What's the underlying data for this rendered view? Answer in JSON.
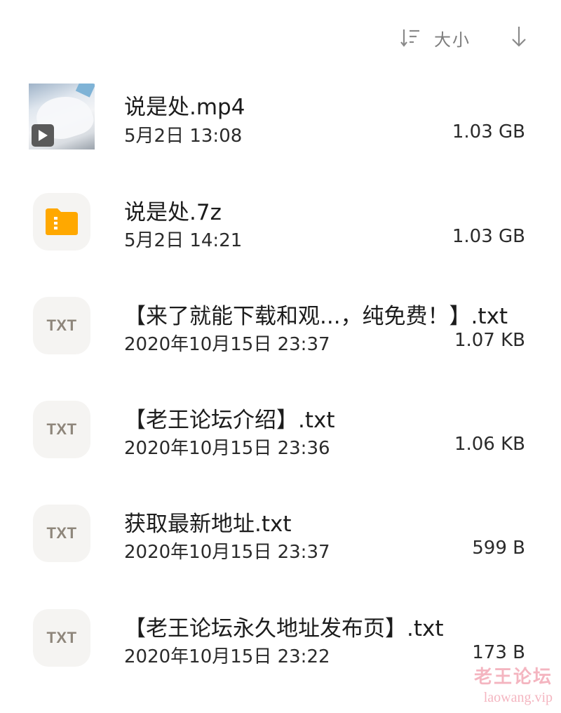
{
  "toolbar": {
    "sort_label": "大小",
    "sort_icon": "sort-list-icon",
    "direction_icon": "arrow-down-icon",
    "accent_color": "#7d7d7d"
  },
  "files": [
    {
      "name": "说是处.mp4",
      "date": "5月2日 13:08",
      "size": "1.03 GB",
      "icon": "video-thumbnail"
    },
    {
      "name": "说是处.7z",
      "date": "5月2日 14:21",
      "size": "1.03 GB",
      "icon": "archive-icon",
      "icon_color": "#ffa800"
    },
    {
      "name": "【来了就能下载和观...，纯免费！】.txt",
      "date": "2020年10月15日 23:37",
      "size": "1.07 KB",
      "icon": "txt-file-icon",
      "icon_label": "TXT"
    },
    {
      "name": "【老王论坛介绍】.txt",
      "date": "2020年10月15日 23:36",
      "size": "1.06 KB",
      "icon": "txt-file-icon",
      "icon_label": "TXT"
    },
    {
      "name": "获取最新地址.txt",
      "date": "2020年10月15日 23:37",
      "size": "599 B",
      "icon": "txt-file-icon",
      "icon_label": "TXT"
    },
    {
      "name": "【老王论坛永久地址发布页】.txt",
      "date": "2020年10月15日 23:22",
      "size": "173 B",
      "icon": "txt-file-icon",
      "icon_label": "TXT"
    }
  ],
  "watermark": {
    "title": "老王论坛",
    "url": "laowang.vip"
  }
}
